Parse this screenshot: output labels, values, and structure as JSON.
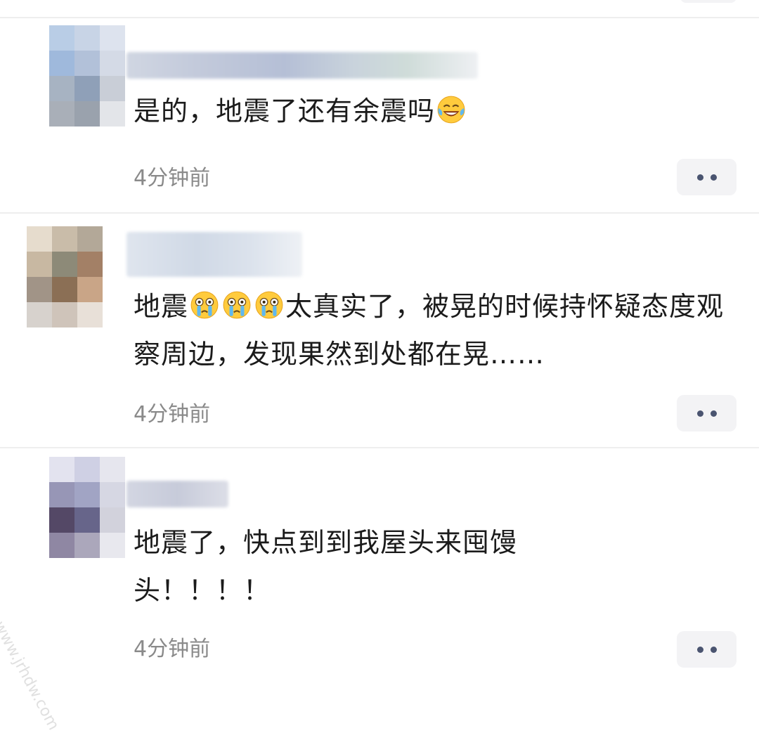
{
  "comments": [
    {
      "text": "是的，地震了还有余震吗",
      "emoji": "laughing-tears-icon",
      "time": "4分钟前"
    },
    {
      "text_prefix": "地震",
      "emojis": [
        "crying-face-icon",
        "crying-face-icon",
        "crying-face-icon"
      ],
      "text_suffix": "太真实了，被晃的时候持怀疑态度观察周边，发现果然到处都在晃……",
      "time": "4分钟前"
    },
    {
      "text": "地震了，快点到到我屋头来囤馒头！！！！",
      "time": "4分钟前"
    }
  ],
  "more_button_icon": "more-dots-icon",
  "watermark": "www.jrhdw.com",
  "colors": {
    "text": "#1b1b1b",
    "time": "#8a8a8a",
    "button_bg": "#f3f3f5",
    "dots": "#4a5470",
    "divider": "#eeeeee"
  }
}
